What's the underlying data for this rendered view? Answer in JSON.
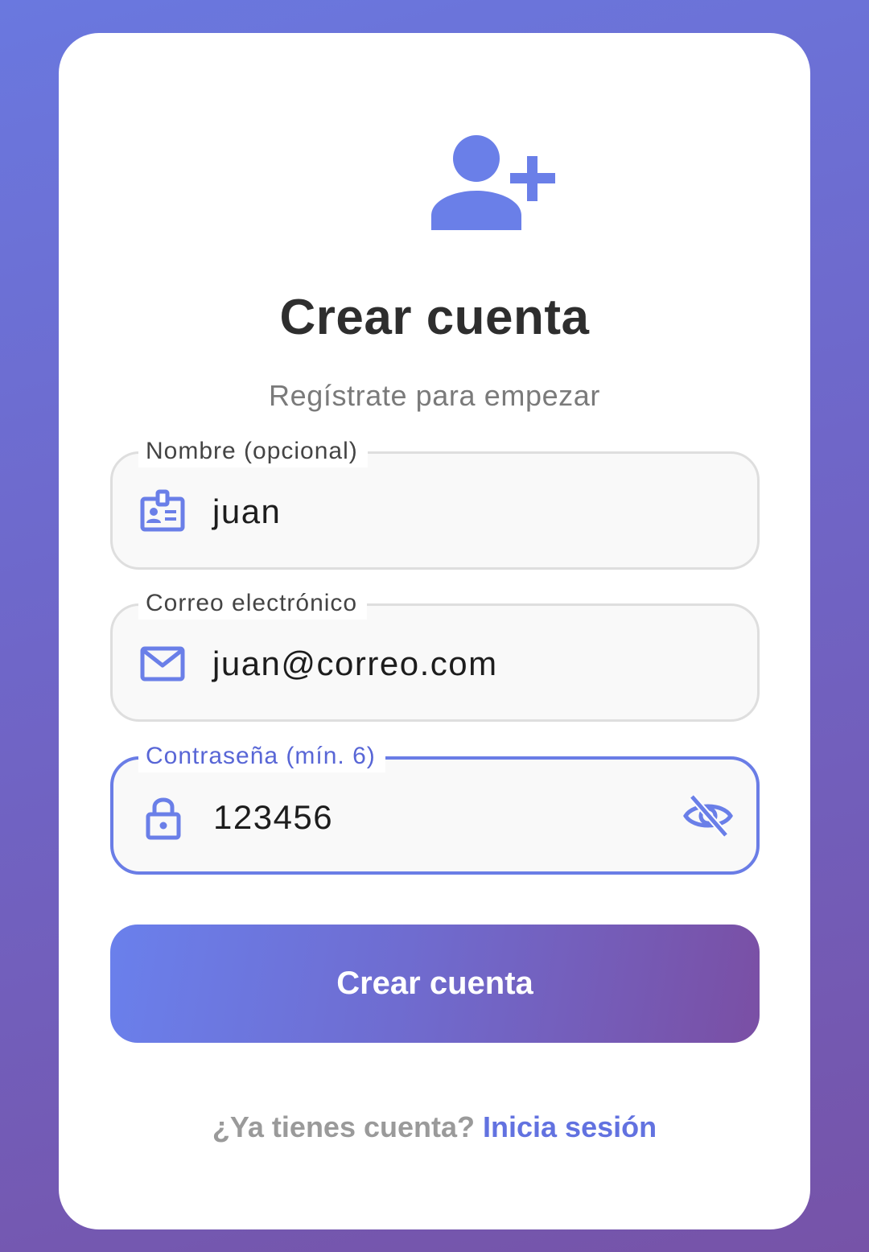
{
  "header": {
    "icon": "person-add-icon",
    "title": "Crear cuenta",
    "subtitle": "Regístrate para empezar"
  },
  "form": {
    "name": {
      "label": "Nombre (opcional)",
      "value": "juan",
      "icon": "badge-icon"
    },
    "email": {
      "label": "Correo electrónico",
      "value": "juan@correo.com",
      "icon": "mail-icon"
    },
    "password": {
      "label": "Contraseña (mín. 6)",
      "value": "123456",
      "icon": "lock-icon",
      "toggle_icon": "eye-off-icon",
      "focused": true
    }
  },
  "submit_label": "Crear cuenta",
  "footer": {
    "prompt": "¿Ya tienes cuenta?",
    "link": "Inicia sesión"
  },
  "colors": {
    "accent": "#6a7de6",
    "gradient_start": "#6a80ec",
    "gradient_end": "#7a4fa4",
    "title": "#2e2e2e",
    "subtitle": "#7a7a7a"
  }
}
